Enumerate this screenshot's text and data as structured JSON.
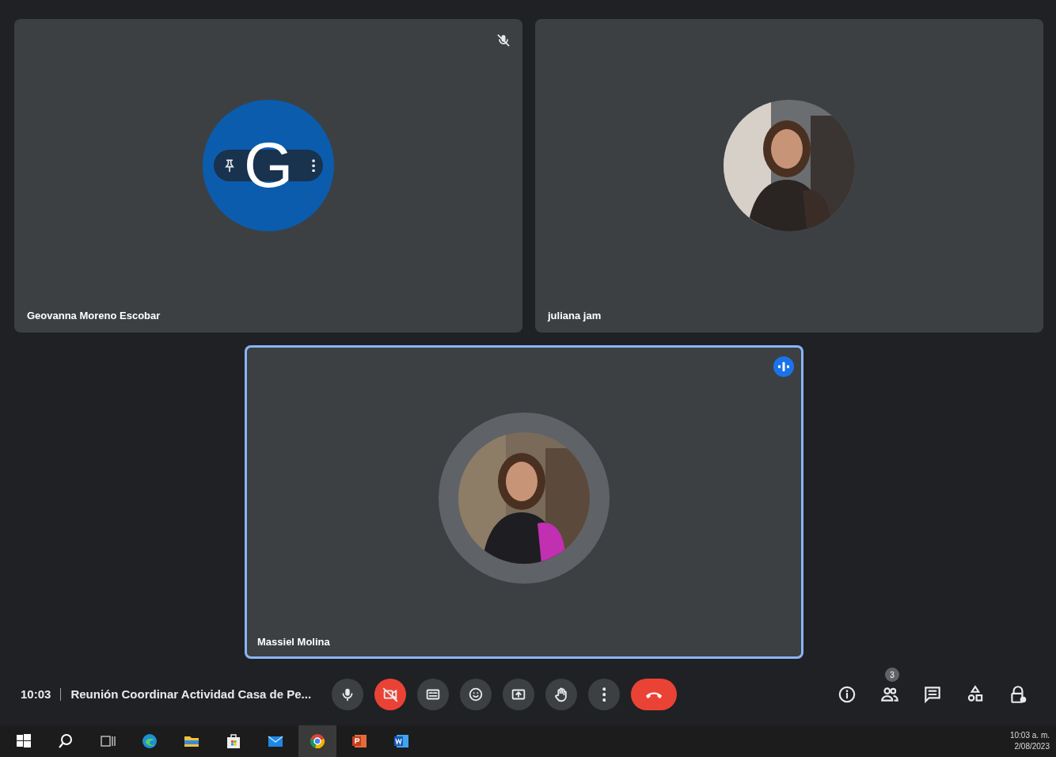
{
  "tiles": [
    {
      "name": "Geovanna Moreno Escobar",
      "avatar": {
        "kind": "initial",
        "letter": "G",
        "color": "#0b5cad"
      },
      "muted": true,
      "speaking": false,
      "hovered": true
    },
    {
      "name": "juliana jam",
      "speaking": false
    },
    {
      "name": "Massiel Molina",
      "speaking": true
    }
  ],
  "meeting": {
    "time": "10:03",
    "title": "Reunión Coordinar Actividad Casa de Pe..."
  },
  "controls": [
    {
      "kind": "mic"
    },
    {
      "kind": "camera",
      "on": false
    },
    {
      "kind": "captions"
    },
    {
      "kind": "emoji"
    },
    {
      "kind": "present"
    },
    {
      "kind": "hand"
    },
    {
      "kind": "more"
    },
    {
      "kind": "leave"
    }
  ],
  "side_controls": [
    {
      "kind": "info"
    },
    {
      "kind": "people",
      "badge": "3"
    },
    {
      "kind": "chat"
    },
    {
      "kind": "activities"
    },
    {
      "kind": "host"
    }
  ],
  "taskbar": {
    "apps": [
      {
        "kind": "start",
        "selected": false
      },
      {
        "kind": "search",
        "selected": false
      },
      {
        "kind": "taskview",
        "selected": false
      },
      {
        "kind": "edge",
        "selected": false
      },
      {
        "kind": "files",
        "selected": false
      },
      {
        "kind": "store",
        "selected": false
      },
      {
        "kind": "mail",
        "selected": false
      },
      {
        "kind": "chrome",
        "selected": true
      },
      {
        "kind": "powerpoint",
        "selected": false
      },
      {
        "kind": "word",
        "selected": false
      }
    ],
    "clock": {
      "time": "10:03 a. m.",
      "date": "2/08/2023"
    }
  }
}
